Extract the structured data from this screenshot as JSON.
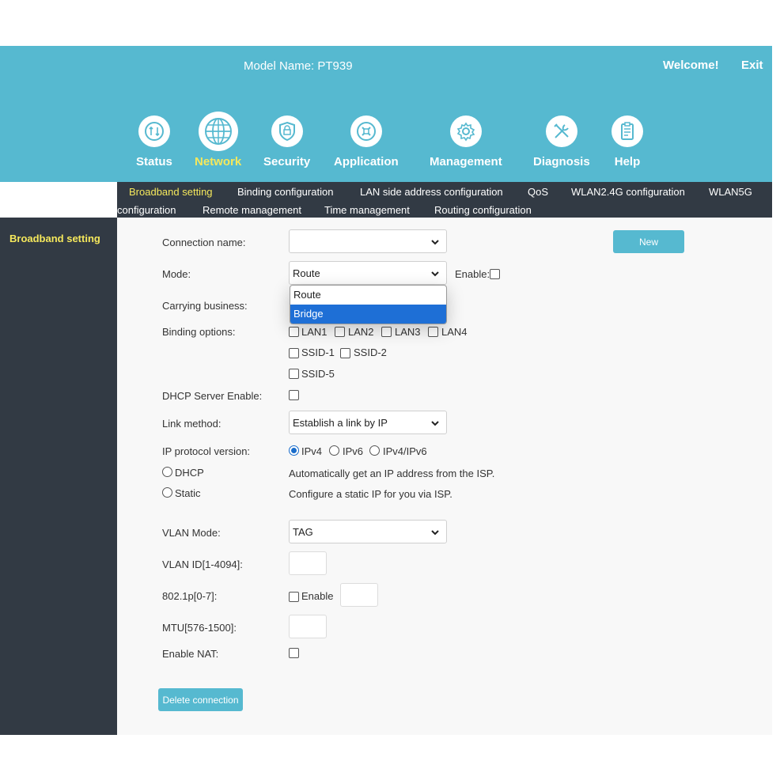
{
  "header": {
    "model_name": "Model Name: PT939",
    "welcome": "Welcome!",
    "exit": "Exit"
  },
  "nav": [
    {
      "label": "Status",
      "icon": "status-icon"
    },
    {
      "label": "Network",
      "icon": "globe-icon",
      "active": true
    },
    {
      "label": "Security",
      "icon": "shield-icon"
    },
    {
      "label": "Application",
      "icon": "application-icon"
    },
    {
      "label": "Management",
      "icon": "gear-icon"
    },
    {
      "label": "Diagnosis",
      "icon": "tools-icon"
    },
    {
      "label": "Help",
      "icon": "clipboard-icon"
    }
  ],
  "subnav": [
    "Broadband setting",
    "Binding configuration",
    "LAN side address configuration",
    "QoS",
    "WLAN2.4G configuration",
    "WLAN5G",
    "configuration",
    "Remote management",
    "Time management",
    "Routing configuration"
  ],
  "sidebar": {
    "items": [
      {
        "label": "Broadband setting"
      }
    ]
  },
  "form": {
    "connection_name_label": "Connection name:",
    "connection_name_value": "",
    "new_button": "New",
    "mode_label": "Mode:",
    "mode_value": "Route",
    "mode_options": [
      "Route",
      "Bridge"
    ],
    "mode_highlighted": "Bridge",
    "enable_label": "Enable:",
    "carrying_business_label": "Carrying business:",
    "binding_options_label": "Binding options:",
    "binding_options": [
      "LAN1",
      "LAN2",
      "LAN3",
      "LAN4",
      "SSID-1",
      "SSID-2",
      "SSID-5"
    ],
    "dhcp_server_label": "DHCP Server Enable:",
    "link_method_label": "Link method:",
    "link_method_value": "Establish a link by IP",
    "ip_protocol_label": "IP protocol version:",
    "ip_protocols": [
      "IPv4",
      "IPv6",
      "IPv4/IPv6"
    ],
    "ip_protocol_selected": "IPv4",
    "dhcp_label": "DHCP",
    "dhcp_desc": "Automatically get an IP address from the ISP.",
    "static_label": "Static",
    "static_desc": "Configure a static IP for you via ISP.",
    "vlan_mode_label": "VLAN Mode:",
    "vlan_mode_value": "TAG",
    "vlan_id_label": "VLAN ID[1-4094]:",
    "p8021_label": "802.1p[0-7]:",
    "p8021_enable": "Enable",
    "mtu_label": "MTU[576-1500]:",
    "enable_nat_label": "Enable NAT:",
    "delete_button": "Delete connection"
  },
  "colors": {
    "header": "#56b9d0",
    "dark": "#323a44",
    "accent_yellow": "#f5e85c",
    "button": "#56b9d0",
    "highlight": "#1e6fd6"
  }
}
